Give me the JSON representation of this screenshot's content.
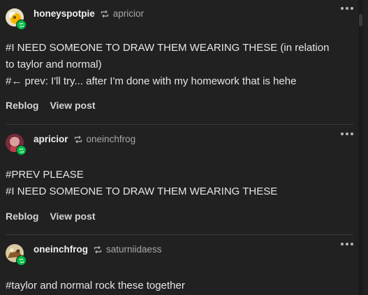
{
  "notes": [
    {
      "author": "honeyspotpie",
      "source": "apricior",
      "tags": [
        "#I NEED SOMEONE TO DRAW THEM WEARING THESE (in relation",
        "to taylor and normal)",
        "#← prev: I'll try... after I'm done with my homework that is hehe"
      ],
      "reblog_label": "Reblog",
      "view_post_label": "View post"
    },
    {
      "author": "apricior",
      "source": "oneinchfrog",
      "tags": [
        "#PREV PLEASE",
        "#I NEED SOMEONE TO DRAW THEM WEARING THESE"
      ],
      "reblog_label": "Reblog",
      "view_post_label": "View post"
    },
    {
      "author": "oneinchfrog",
      "source": "saturniidaess",
      "tags": [
        "#taylor and normal rock these together"
      ]
    }
  ],
  "icons": {
    "reblog": "reblog-icon",
    "more": "more-options-icon",
    "badge": "reblog-badge-icon"
  },
  "colors": {
    "background": "#212121",
    "badge": "#00b845",
    "muted_text": "#a8a8a8"
  }
}
